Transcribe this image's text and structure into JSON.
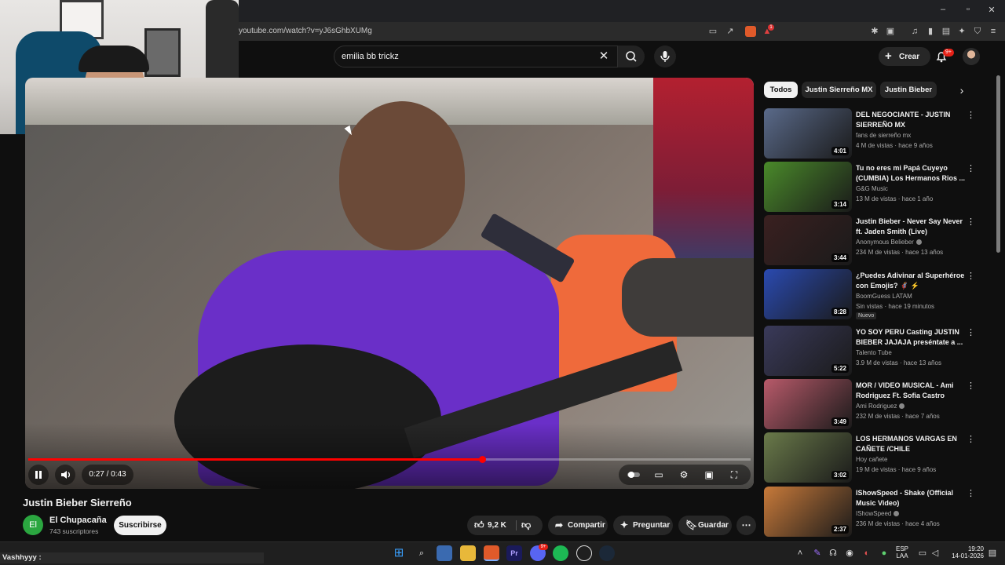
{
  "browser": {
    "url": "youtube.com/watch?v=yJ6sGhbXUMg",
    "window_controls": [
      "minimize",
      "maximize",
      "close"
    ],
    "extension_badge": "1"
  },
  "header": {
    "search_value": "emilia bb trickz",
    "create_label": "Crear",
    "notifications_badge": "9+"
  },
  "player": {
    "time": "0:27 / 0:43",
    "progress_fraction": 0.628,
    "title": "Justin Bieber Sierreño"
  },
  "channel": {
    "avatar_initials": "El",
    "name": "El Chupacaña",
    "subscribers": "743 suscriptores",
    "subscribe_label": "Suscribirse"
  },
  "actions": {
    "likes": "9,2 K",
    "share": "Compartir",
    "ask": "Preguntar",
    "save": "Guardar"
  },
  "chips": [
    "Todos",
    "Justin Sierreño MX",
    "Justin Bieber"
  ],
  "recommendations": [
    {
      "title": "DEL NEGOCIANTE  - JUSTIN SIERREÑO MX",
      "channel": "fans de sierreño mx",
      "meta": "4 M de vistas · hace 9 años",
      "duration": "4:01",
      "verified": false,
      "badge": "",
      "color": "#5a6a8a"
    },
    {
      "title": "Tu no eres mi Papá Cuyeyo (CUMBIA) Los Hermanos Rios ...",
      "channel": "G&G Music",
      "meta": "13 M de vistas · hace 1 año",
      "duration": "3:14",
      "verified": false,
      "badge": "",
      "color": "#4a8a2a"
    },
    {
      "title": "Justin Bieber - Never Say Never ft. Jaden Smith (Live)",
      "channel": "Anonymous Belieber",
      "meta": "234 M de vistas · hace 13 años",
      "duration": "3:44",
      "verified": true,
      "badge": "",
      "color": "#3a2020"
    },
    {
      "title": "¿Puedes Adivinar al Superhéroe con Emojis? 🦸 ⚡",
      "channel": "BoomGuess LATAM",
      "meta": "Sin vistas · hace 19 minutos",
      "duration": "8:28",
      "verified": false,
      "badge": "Nuevo",
      "color": "#2a4ab0"
    },
    {
      "title": "YO SOY PERU Casting JUSTIN BIEBER JAJAJA  preséntate a ...",
      "channel": "Talento Tube",
      "meta": "3.9 M de vistas · hace 13 años",
      "duration": "5:22",
      "verified": false,
      "badge": "",
      "color": "#3a3a5a"
    },
    {
      "title": "MOR / VIDEO MUSICAL - Ami Rodriguez Ft. Sofia Castro",
      "channel": "Ami Rodriguez",
      "meta": "232 M de vistas · hace 7 años",
      "duration": "3:49",
      "verified": true,
      "badge": "",
      "color": "#b85a6a"
    },
    {
      "title": "LOS HERMANOS VARGAS EN CAÑETE /CHILE",
      "channel": "Hoy cañete",
      "meta": "19 M de vistas · hace 9 años",
      "duration": "3:02",
      "verified": false,
      "badge": "",
      "color": "#6a7a4a"
    },
    {
      "title": "IShowSpeed - Shake (Official Music Video)",
      "channel": "IShowSpeed",
      "meta": "236 M de vistas · hace 4 años",
      "duration": "2:37",
      "verified": true,
      "badge": "",
      "color": "#c87a3a"
    }
  ],
  "chat": {
    "line": "Vashhyyy :"
  },
  "taskbar": {
    "lang_line1": "ESP",
    "lang_line2": "LAA",
    "time": "19:20",
    "date": "14-01-2026",
    "discord_badge": "9+"
  }
}
